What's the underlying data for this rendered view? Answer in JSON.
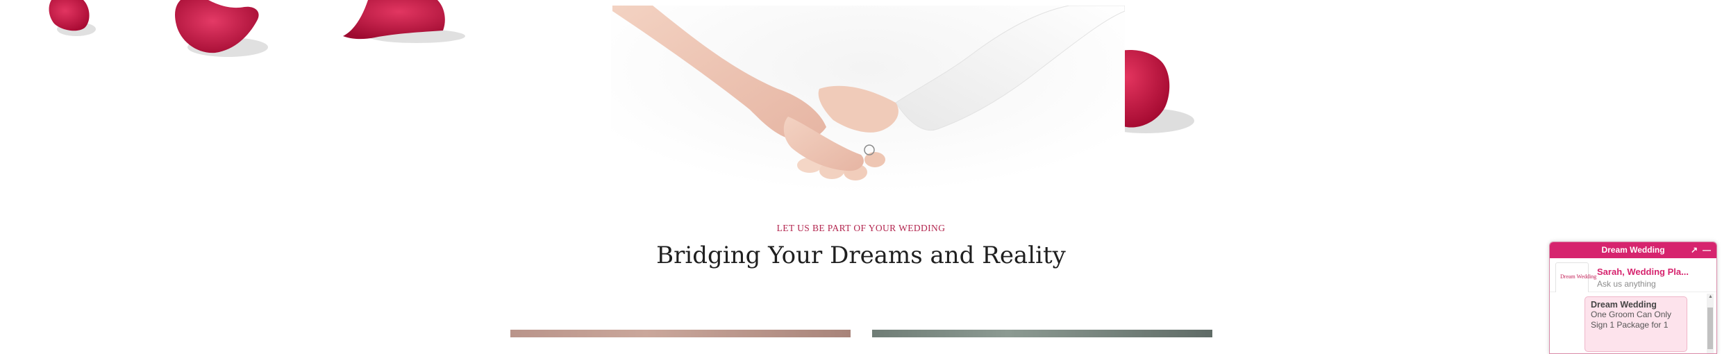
{
  "section": {
    "eyebrow": "LET US BE PART OF YOUR WEDDING",
    "headline": "Bridging Your Dreams and Reality"
  },
  "chat": {
    "title": "Dream Wedding",
    "popout_icon": "popout-icon",
    "minimize_icon": "minimize-icon",
    "agent_name": "Sarah, Wedding Pla...",
    "agent_subtitle": "Ask us anything",
    "avatar_logo": "Dream Wedding",
    "message": {
      "title": "Dream Wedding",
      "text": "One Groom Can Only Sign 1 Package for 1"
    }
  },
  "colors": {
    "accent": "#d6246e",
    "eyebrow": "#b3264f",
    "petal": "#c8103e",
    "headline": "#1f1f1f"
  }
}
